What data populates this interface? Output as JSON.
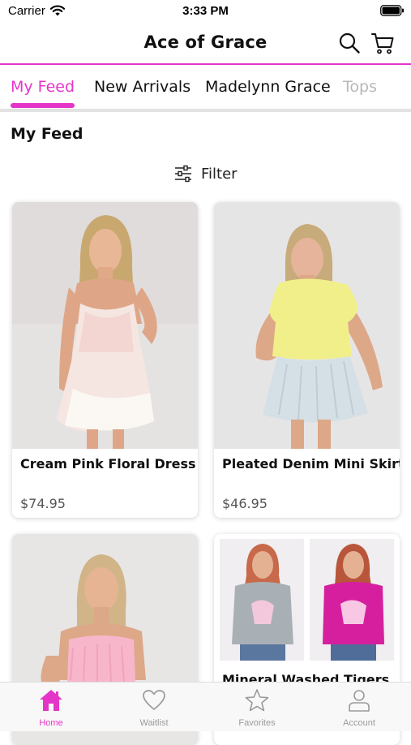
{
  "status_bar": {
    "carrier": "Carrier",
    "time": "3:33 PM"
  },
  "header": {
    "title": "Ace of Grace",
    "search_icon": "search-icon",
    "cart_icon": "cart-icon"
  },
  "tabs": [
    {
      "label": "My Feed",
      "active": true
    },
    {
      "label": "New Arrivals",
      "active": false
    },
    {
      "label": "Madelynn Grace",
      "active": false
    },
    {
      "label": "Tops",
      "active": false
    }
  ],
  "feed": {
    "title": "My Feed",
    "filter_label": "Filter",
    "filter_icon": "sliders-icon"
  },
  "products": [
    {
      "name": "Cream Pink Floral Dress",
      "price": "$74.95"
    },
    {
      "name": "Pleated Denim Mini Skirt",
      "price": "$46.95"
    },
    {
      "name": "",
      "price": ""
    },
    {
      "name": "Mineral Washed Tigers",
      "price": ""
    }
  ],
  "bottom_nav": [
    {
      "label": "Home",
      "icon": "home-icon",
      "active": true
    },
    {
      "label": "Waitlist",
      "icon": "heart-icon",
      "active": false
    },
    {
      "label": "Favorites",
      "icon": "star-icon",
      "active": false
    },
    {
      "label": "Account",
      "icon": "person-icon",
      "active": false
    }
  ],
  "colors": {
    "accent": "#e535c8",
    "inactive": "#9a9a9a"
  }
}
